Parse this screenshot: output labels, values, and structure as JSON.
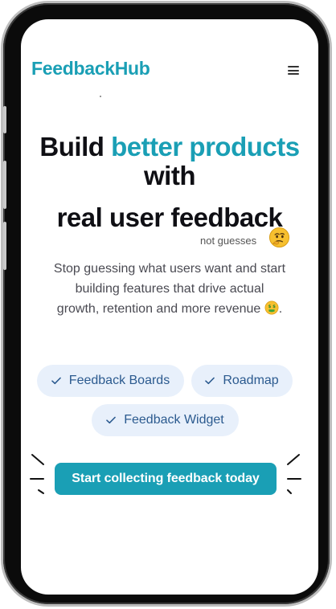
{
  "header": {
    "brand": "FeedbackHub",
    "menu_icon": "hamburger-menu-icon"
  },
  "hero": {
    "headline_part1": "Build ",
    "headline_accent": "better products",
    "headline_line2": "with",
    "headline_line3": "real user feedback",
    "aside": "not guesses",
    "aside_icon": "thinking-face-emoji",
    "subtext": "Stop guessing what users want and start building features that drive actual growth, retention and more revenue",
    "subtext_icon": "money-mouth-face-emoji",
    "subtext_end": "."
  },
  "features": [
    {
      "label": "Feedback Boards",
      "icon": "check-icon"
    },
    {
      "label": "Roadmap",
      "icon": "check-icon"
    },
    {
      "label": "Feedback Widget",
      "icon": "check-icon"
    }
  ],
  "cta": {
    "label": "Start collecting feedback today"
  },
  "colors": {
    "accent": "#1a9fb5",
    "pill_bg": "#e8f0fb",
    "pill_text": "#2b5a8f",
    "headline": "#0f0f14"
  }
}
